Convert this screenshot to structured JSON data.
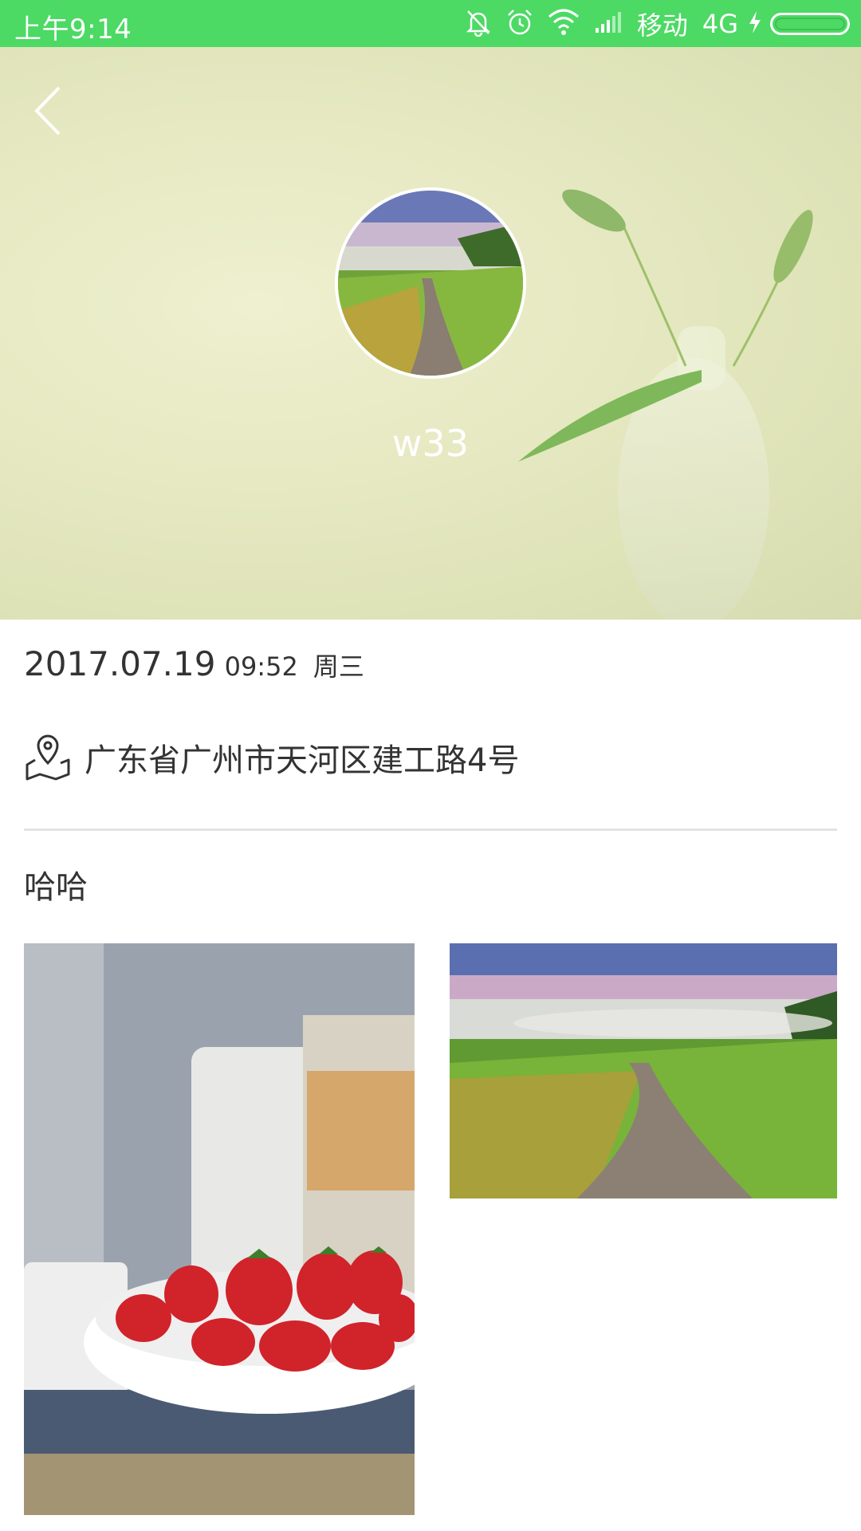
{
  "status_bar": {
    "time": "上午9:14",
    "carrier": "移动",
    "network": "4G",
    "icons": [
      "mute-icon",
      "alarm-icon",
      "wifi-icon",
      "signal-icon",
      "charging-icon",
      "battery-icon"
    ],
    "battery_level": 1.0
  },
  "header": {
    "back_icon": "chevron-left-icon",
    "username": "w33"
  },
  "post": {
    "date": "2017.07.19",
    "time": "09:52",
    "weekday": "周三",
    "location_icon": "map-pin-icon",
    "location": "广东省广州市天河区建工路4号",
    "text": "哈哈",
    "photos": [
      "strawberries-photo",
      "country-road-photo"
    ]
  },
  "colors": {
    "status_bar": "#4cd964",
    "text": "#333333",
    "divider": "#e3e3e3"
  }
}
